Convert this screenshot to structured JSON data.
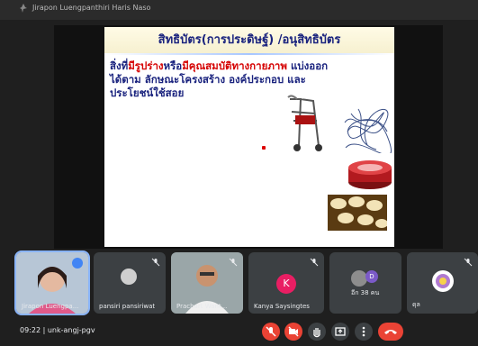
{
  "meeting": {
    "top_name": "Jirapon Luengpanthiri Haris Naso",
    "clock": "09:22",
    "separator": "|",
    "meeting_code": "unk-angj-pgv"
  },
  "slide": {
    "title": "สิทธิบัตร(การประดิษฐ์) /อนุสิทธิบัตร",
    "line1_a": "สิ่งที่",
    "line1_red1": "มีรูปร่าง",
    "line1_b": "หรือ",
    "line1_red2": "มีคุณสมบัติทางกายภาพ",
    "line1_c": " แบ่งออก",
    "line2": "ได้ตาม ลักษณะโครงสร้าง องค์ประกอบ และ",
    "line3": "ประโยชน์ใช้สอย"
  },
  "participants": [
    {
      "name": "Jirapon Luengpa...",
      "type": "video",
      "speaking": true
    },
    {
      "name": "pansiri pansiriwat",
      "type": "avatar-photo",
      "muted": true
    },
    {
      "name": "Prachart Want...",
      "type": "video",
      "muted": true
    },
    {
      "name": "Kanya Saysingtes",
      "type": "initial",
      "initial": "K",
      "muted": true
    },
    {
      "name": "อีก 38 คน",
      "type": "more",
      "initial": "D"
    },
    {
      "name": "ดุล",
      "type": "avatar-photo",
      "muted": true
    }
  ],
  "colors": {
    "accent": "#8ab4f8",
    "end_call": "#ea4335",
    "tile_bg": "#3c4043",
    "slide_title": "#1a237e",
    "slide_red": "#d50000"
  },
  "icons": [
    "mic-off-icon",
    "camera-off-icon",
    "raise-hand-icon",
    "present-icon",
    "more-options-icon",
    "end-call-icon"
  ]
}
